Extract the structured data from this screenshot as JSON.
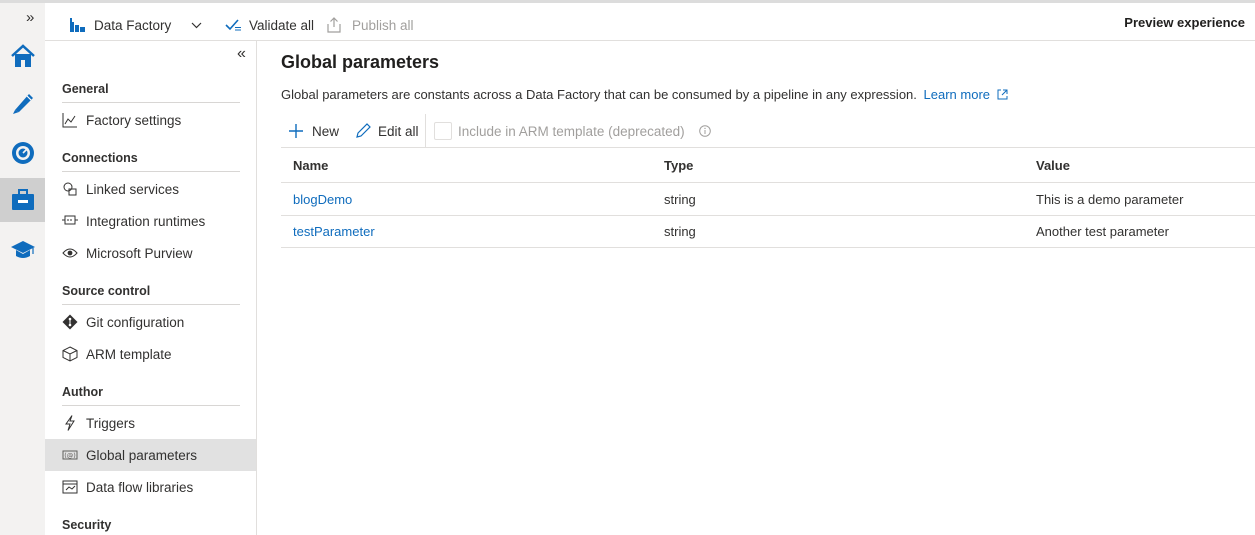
{
  "toolbar": {
    "factory_name": "Data Factory",
    "validate_label": "Validate all",
    "publish_label": "Publish all",
    "preview_label": "Preview experience"
  },
  "rail": {
    "expand_glyph": "»",
    "items": [
      "home-icon",
      "author-pencil-icon",
      "monitor-gauge-icon",
      "manage-toolbox-icon",
      "learning-cap-icon"
    ],
    "active": "manage-toolbox-icon"
  },
  "sidebar": {
    "collapse_glyph": "«",
    "sections": {
      "general": "General",
      "connections": "Connections",
      "source_control": "Source control",
      "author": "Author",
      "security": "Security"
    },
    "items": {
      "factory_settings": "Factory settings",
      "linked_services": "Linked services",
      "integration_runtimes": "Integration runtimes",
      "purview": "Microsoft Purview",
      "git": "Git configuration",
      "arm": "ARM template",
      "triggers": "Triggers",
      "global_parameters": "Global parameters",
      "data_flow_libraries": "Data flow libraries"
    },
    "active_item": "Global parameters"
  },
  "main": {
    "title": "Global parameters",
    "description": "Global parameters are constants across a Data Factory that can be consumed by a pipeline in any expression.",
    "learn_more": "Learn more",
    "commands": {
      "new": "New",
      "edit_all": "Edit all",
      "include_arm": "Include in ARM template (deprecated)"
    },
    "columns": [
      "Name",
      "Type",
      "Value"
    ],
    "rows": [
      {
        "name": "blogDemo",
        "type": "string",
        "value": "This is a demo parameter"
      },
      {
        "name": "testParameter",
        "type": "string",
        "value": "Another test parameter"
      }
    ]
  },
  "colors": {
    "accent": "#0f6cbd",
    "rail_bg": "#f3f2f1",
    "active_bg": "#e1e1e1"
  }
}
